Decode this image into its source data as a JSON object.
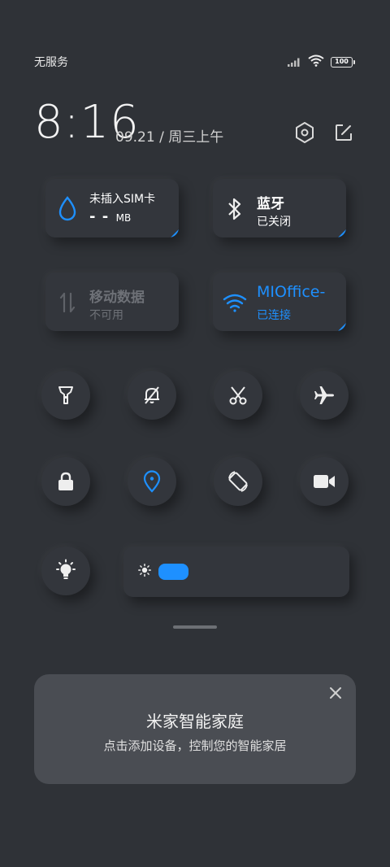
{
  "status_bar": {
    "carrier": "无服务",
    "battery": "100",
    "icons": [
      "signal-icon",
      "wifi-icon",
      "battery-icon"
    ]
  },
  "header": {
    "time": "8:16",
    "date": "09.21 / 周三上午",
    "buttons": [
      "settings-icon",
      "edit-icon"
    ]
  },
  "tiles": {
    "data_usage": {
      "title": "未插入SIM卡",
      "value": "- -",
      "unit": "MB",
      "icon": "water-drop-icon"
    },
    "bluetooth": {
      "title": "蓝牙",
      "status": "已关闭",
      "icon": "bluetooth-icon"
    },
    "mobile_data": {
      "title": "移动数据",
      "status": "不可用",
      "icon": "data-arrows-icon"
    },
    "wifi": {
      "title": "MIOffice-",
      "status": "已连接",
      "icon": "wifi-icon"
    }
  },
  "toggles": [
    {
      "name": "flashlight",
      "icon": "flashlight-icon",
      "active": false
    },
    {
      "name": "silent",
      "icon": "bell-off-icon",
      "active": false
    },
    {
      "name": "screenshot",
      "icon": "scissors-icon",
      "active": false
    },
    {
      "name": "airplane",
      "icon": "airplane-icon",
      "active": false
    },
    {
      "name": "lock",
      "icon": "lock-icon",
      "active": false
    },
    {
      "name": "location",
      "icon": "location-icon",
      "active": true
    },
    {
      "name": "auto-rotate",
      "icon": "rotate-icon",
      "active": false
    },
    {
      "name": "screen-record",
      "icon": "video-camera-icon",
      "active": false
    },
    {
      "name": "reading-mode",
      "icon": "lightbulb-icon",
      "active": false
    }
  ],
  "brightness": {
    "level": 0.13,
    "icon": "sun-icon"
  },
  "mijia_card": {
    "title": "米家智能家庭",
    "subtitle": "点击添加设备，控制您的智能家居"
  },
  "colors": {
    "background": "#2f3237",
    "accent": "#1e90ff",
    "disabled_text": "#6e7177",
    "card": "#4a4d53"
  }
}
